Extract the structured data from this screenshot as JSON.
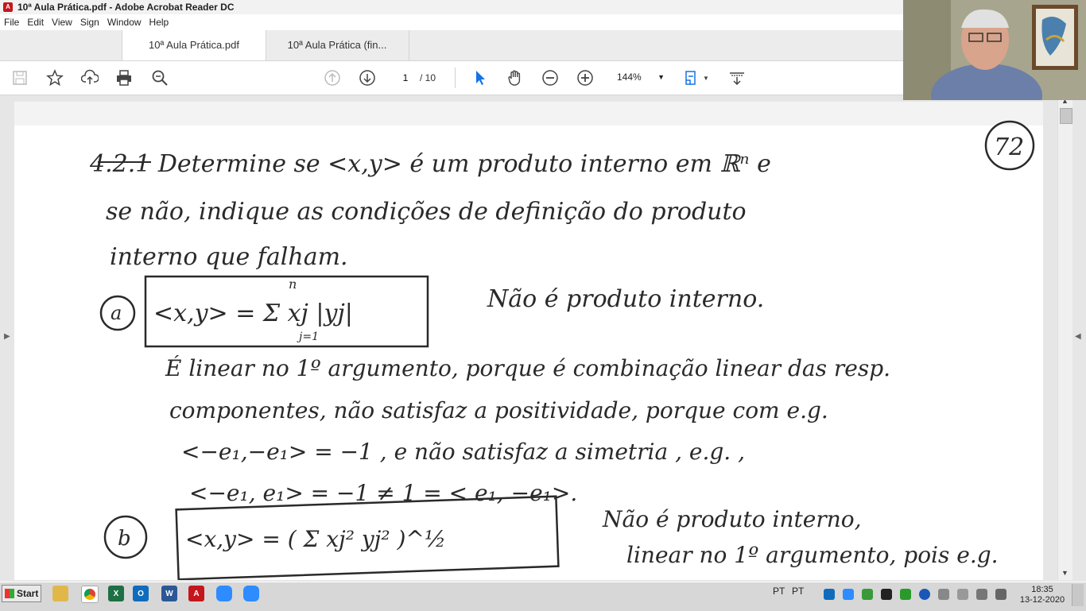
{
  "window": {
    "title": "10ª Aula Prática.pdf - Adobe Acrobat Reader DC",
    "app_icon": "pdf-icon",
    "app_icon_label": "A"
  },
  "menu": [
    "File",
    "Edit",
    "View",
    "Sign",
    "Window",
    "Help"
  ],
  "tabs": [
    {
      "label": "10ª Aula Prática.pdf",
      "active": true
    },
    {
      "label": "10ª Aula Prática (fin...",
      "active": false
    }
  ],
  "toolbar": {
    "icons_left": [
      "save-icon",
      "star-icon",
      "upload-icon",
      "print-icon",
      "search-zoom-icon"
    ],
    "page_current": "1",
    "page_total": "/ 10",
    "zoom": "144%",
    "accent": "#1473e6"
  },
  "document": {
    "lines": [
      "4.2.1  Determine se <x,y> é um produto interno em ℝⁿ e",
      "se não, indique as condições de definição do produto",
      "interno que falham.",
      "Não é produto interno.",
      "É linear no 1º argumento, porque é combinação linear das resp.",
      "componentes, não satisfaz a positividade, porque com e.g.",
      "<−e₁,−e₁> = −1 , e não satisfaz a simetria , e.g. ,",
      "<−e₁, e₁> = −1 ≠ 1 = < e₁, −e₁>.",
      "Não é produto interno,",
      "linear no 1º argumento, pois e.g."
    ],
    "page_number_mark": "72",
    "item_a": "a",
    "item_b": "b",
    "formula_a": "<x,y> = Σ xj |yj|",
    "formula_b": "<x,y> = ( Σ xj² yj² )^½",
    "sum_lower": "j=1",
    "sum_upper": "n"
  },
  "taskbar": {
    "start": "Start",
    "apps": [
      "folder-icon",
      "chrome-icon",
      "excel-icon",
      "outlook-icon",
      "word-icon",
      "acrobat-icon",
      "zoom-icon",
      "zoom-icon"
    ],
    "app_letters": [
      "",
      "",
      "X",
      "O",
      "W",
      "A",
      "",
      ""
    ],
    "lang1": "PT",
    "lang2": "PT",
    "time": "18:35",
    "date": "13-12-2020"
  }
}
